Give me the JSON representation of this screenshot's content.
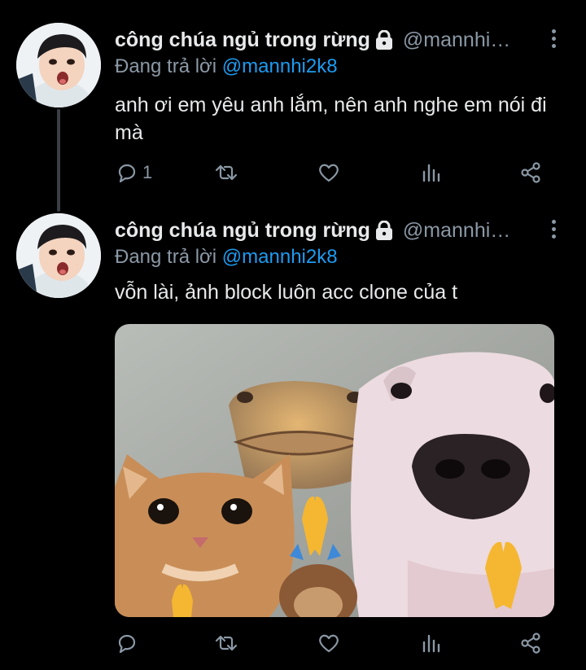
{
  "tweets": [
    {
      "author_name": "công chúa ngủ trong rừng",
      "handle": "@mannhi2k8",
      "reply_prefix": "Đang trả lời",
      "reply_to": "@mannhi2k8",
      "text": "anh ơi em yêu anh lắm, nên anh nghe em nói đi mà",
      "reply_count": "1"
    },
    {
      "author_name": "công chúa ngủ trong rừng",
      "handle": "@mannhi2k8",
      "reply_prefix": "Đang trả lời",
      "reply_to": "@mannhi2k8",
      "text": "vỗn lài, ảnh block luôn acc clone của t",
      "reply_count": ""
    }
  ],
  "icons": {
    "lock": "lock-icon",
    "more": "more-vertical-icon",
    "reply": "reply-icon",
    "retweet": "retweet-icon",
    "like": "heart-icon",
    "analytics": "analytics-icon",
    "share": "share-icon"
  },
  "colors": {
    "background": "#000000",
    "text": "#e7e9ea",
    "secondary": "#8b98a5",
    "mention": "#1d9bf0"
  }
}
